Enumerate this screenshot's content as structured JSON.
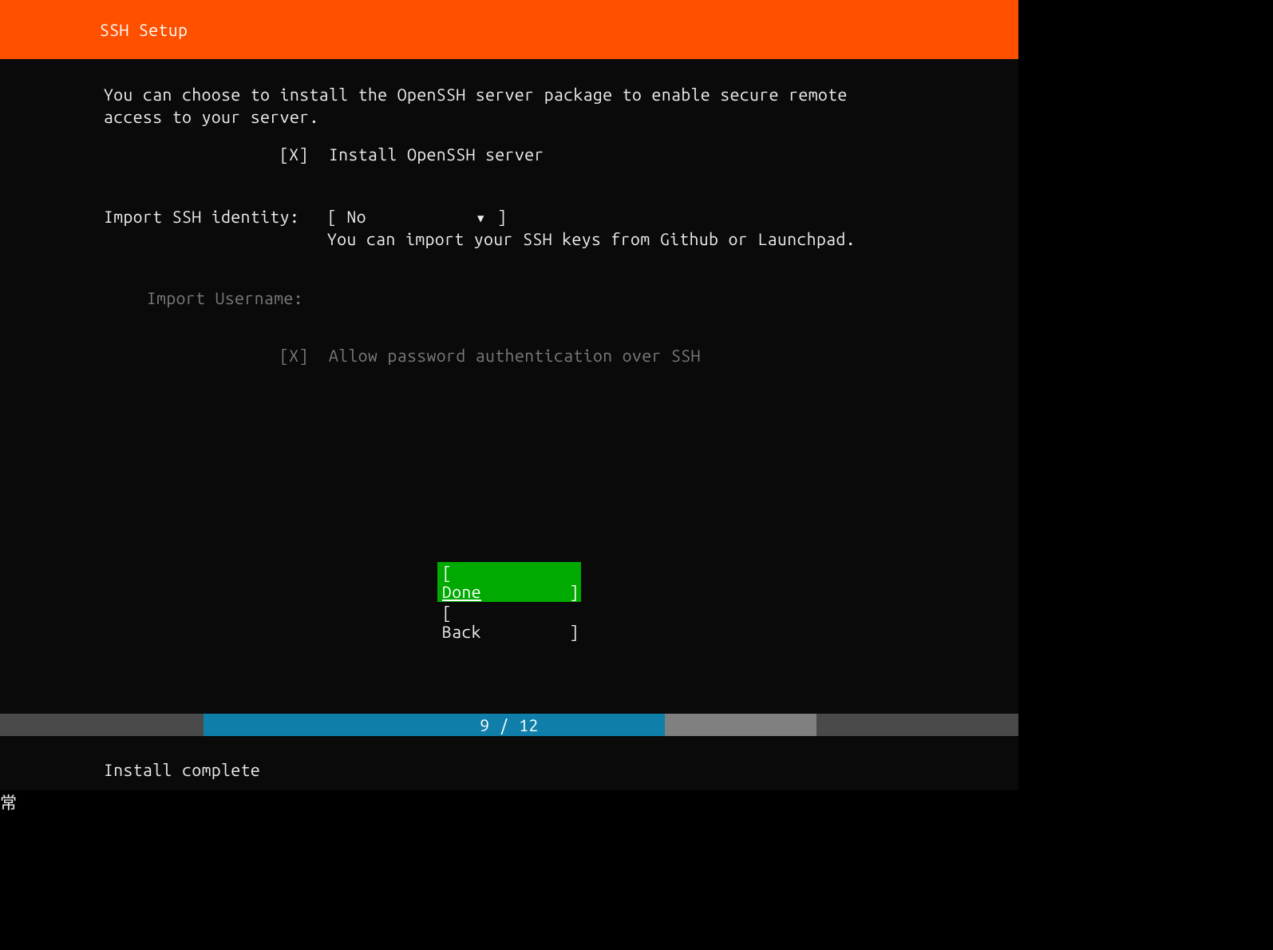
{
  "header": {
    "title": "SSH Setup"
  },
  "intro": "You can choose to install the OpenSSH server package to enable secure remote\naccess to your server.",
  "install_checkbox": {
    "mark": "[X]",
    "label": "Install OpenSSH server"
  },
  "import_identity": {
    "label": "Import SSH identity:",
    "dropdown_open": "[ ",
    "dropdown_value": "No",
    "dropdown_close": " ]",
    "help": "You can import your SSH keys from Github or Launchpad."
  },
  "import_username": {
    "label": "Import Username:"
  },
  "allow_password": {
    "mark": "[X]",
    "label": "Allow password authentication over SSH"
  },
  "buttons": {
    "done_open": "[ ",
    "done_label": "Done",
    "done_close": "    ]",
    "back_open": "[ ",
    "back_label": "Back",
    "back_close": "    ]"
  },
  "progress": {
    "text": "9 / 12"
  },
  "status": "Install complete"
}
